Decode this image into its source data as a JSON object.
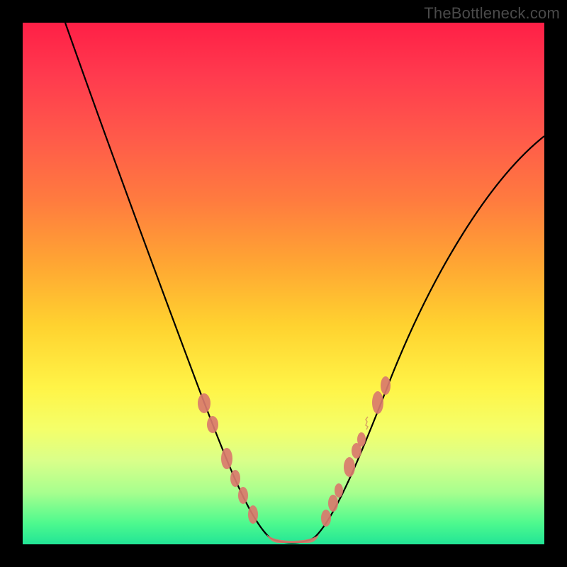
{
  "watermark": "TheBottleneck.com",
  "colors": {
    "frame": "#000000",
    "curve": "#000000",
    "bump": "#d9796c",
    "gradient_stops": [
      "#ff1f46",
      "#ff3a4e",
      "#ff5a4a",
      "#ff7b3f",
      "#ffa533",
      "#ffd22f",
      "#fff447",
      "#f4ff6a",
      "#d9ff8a",
      "#a8ff8e",
      "#4df98e",
      "#22e596"
    ]
  },
  "chart_data": {
    "type": "line",
    "title": "",
    "xlabel": "",
    "ylabel": "",
    "xlim": [
      0,
      100
    ],
    "ylim": [
      0,
      100
    ],
    "grid": false,
    "legend": false,
    "x": [
      0,
      4,
      8,
      12,
      16,
      20,
      24,
      28,
      32,
      34,
      36,
      38,
      40,
      42,
      44,
      46,
      48,
      50,
      52,
      54,
      56,
      58,
      60,
      62,
      64,
      68,
      72,
      76,
      80,
      84,
      88,
      92,
      96,
      100
    ],
    "values": [
      100,
      92,
      84,
      76,
      67,
      58,
      49,
      40,
      31,
      27,
      23,
      19,
      15,
      11,
      7,
      4,
      1,
      0,
      0,
      0,
      1,
      4,
      8,
      13,
      18,
      26,
      33,
      40,
      46,
      52,
      57,
      62,
      66,
      70
    ],
    "annotations": {
      "valley_floor_x_range": [
        47,
        56
      ],
      "left_bump_x_positions": [
        34.5,
        36.8,
        39.7,
        41.3,
        42.8,
        44.6
      ],
      "right_bump_x_positions": [
        57.5,
        59.3,
        60.4,
        62.8,
        64.2,
        65.0,
        68.5,
        70.0
      ]
    }
  }
}
